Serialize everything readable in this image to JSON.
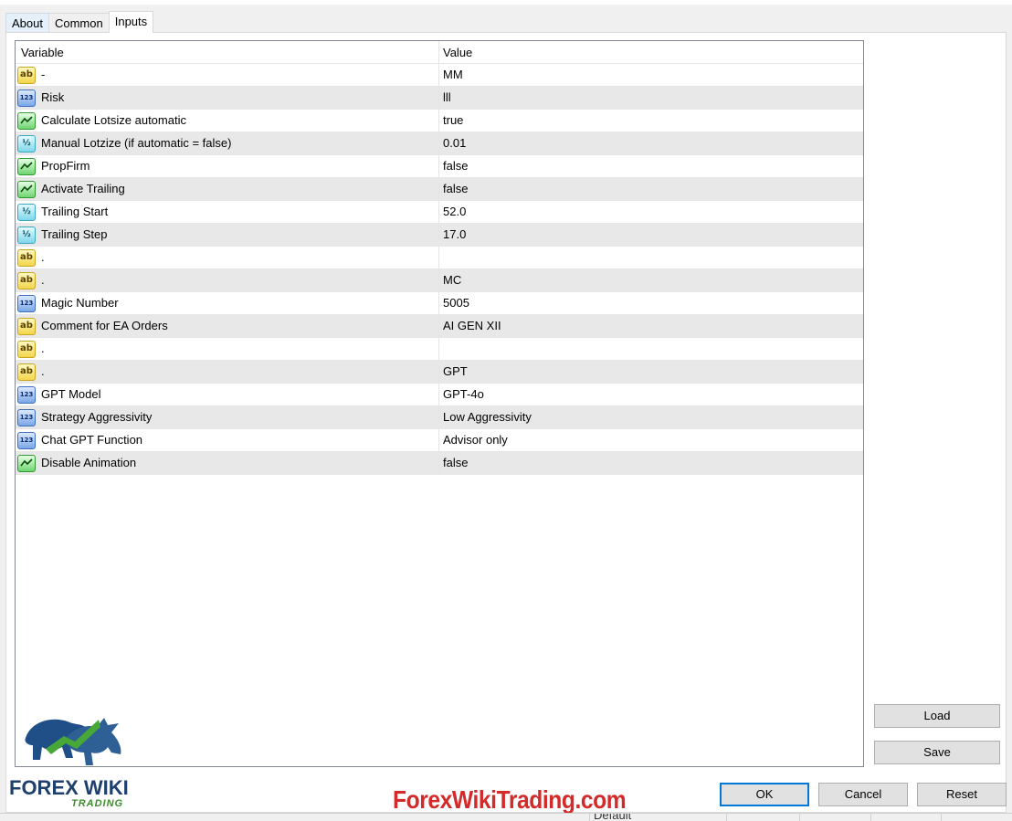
{
  "tabs": [
    {
      "label": "About"
    },
    {
      "label": "Common"
    },
    {
      "label": "Inputs"
    }
  ],
  "grid": {
    "headers": {
      "variable": "Variable",
      "value": "Value"
    },
    "rows": [
      {
        "icon": "string-icon",
        "type": "str",
        "variable": "-",
        "value": " MM"
      },
      {
        "icon": "integer-icon",
        "type": "int",
        "variable": "Risk",
        "value": "lll"
      },
      {
        "icon": "bool-icon",
        "type": "bool",
        "variable": "Calculate Lotsize automatic",
        "value": "true"
      },
      {
        "icon": "double-icon",
        "type": "dbl",
        "variable": "Manual Lotzize (if automatic = false)",
        "value": "0.01"
      },
      {
        "icon": "bool-icon",
        "type": "bool",
        "variable": "PropFirm",
        "value": "false"
      },
      {
        "icon": "bool-icon",
        "type": "bool",
        "variable": "Activate Trailing",
        "value": "false"
      },
      {
        "icon": "double-icon",
        "type": "dbl",
        "variable": "Trailing Start",
        "value": "52.0"
      },
      {
        "icon": "double-icon",
        "type": "dbl",
        "variable": "Trailing Step",
        "value": "17.0"
      },
      {
        "icon": "string-icon",
        "type": "str",
        "variable": " .",
        "value": ""
      },
      {
        "icon": "string-icon",
        "type": "str",
        "variable": " .",
        "value": " MC"
      },
      {
        "icon": "integer-icon",
        "type": "int",
        "variable": "Magic Number",
        "value": "5005"
      },
      {
        "icon": "string-icon",
        "type": "str",
        "variable": "Comment for EA Orders",
        "value": "AI GEN XII"
      },
      {
        "icon": "string-icon",
        "type": "str",
        "variable": " .",
        "value": ""
      },
      {
        "icon": "string-icon",
        "type": "str",
        "variable": " .",
        "value": " GPT"
      },
      {
        "icon": "integer-icon",
        "type": "int",
        "variable": "GPT Model",
        "value": "GPT-4o"
      },
      {
        "icon": "integer-icon",
        "type": "int",
        "variable": "Strategy Aggressivity",
        "value": "Low Aggressivity"
      },
      {
        "icon": "integer-icon",
        "type": "int",
        "variable": "Chat GPT Function",
        "value": "Advisor only"
      },
      {
        "icon": "bool-icon",
        "type": "bool",
        "variable": "Disable Animation",
        "value": "false"
      }
    ]
  },
  "buttons": {
    "load": "Load",
    "save": "Save",
    "ok": "OK",
    "cancel": "Cancel",
    "reset": "Reset"
  },
  "logo": {
    "main": "FOREX WIKI",
    "sub": "TRADING"
  },
  "watermark": "ForexWikiTrading.com",
  "below_window_text": "Default"
}
